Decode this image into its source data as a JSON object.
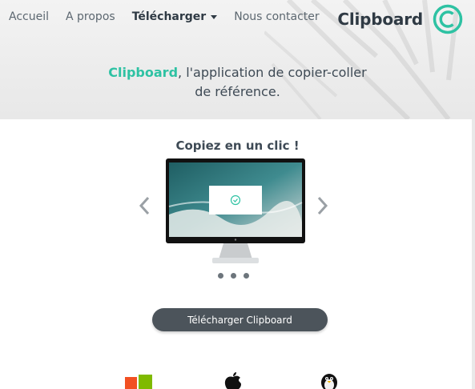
{
  "nav": {
    "items": [
      {
        "label": "Accueil"
      },
      {
        "label": "A propos"
      },
      {
        "label": "Télécharger"
      },
      {
        "label": "Nous contacter"
      }
    ]
  },
  "brand": {
    "name": "Clipboard",
    "accent_color": "#2ec2a3"
  },
  "hero": {
    "tagline_brand": "Clipboard",
    "tagline_line1": ", l'application de copier-coller",
    "tagline_line2": "de référence."
  },
  "carousel": {
    "title": "Copiez en un clic !",
    "slides_count": 3,
    "active_slide": 1
  },
  "download": {
    "button_label": "Télécharger Clipboard"
  },
  "platforms": [
    {
      "icon": "windows-icon"
    },
    {
      "icon": "apple-icon"
    },
    {
      "icon": "linux-icon"
    }
  ]
}
